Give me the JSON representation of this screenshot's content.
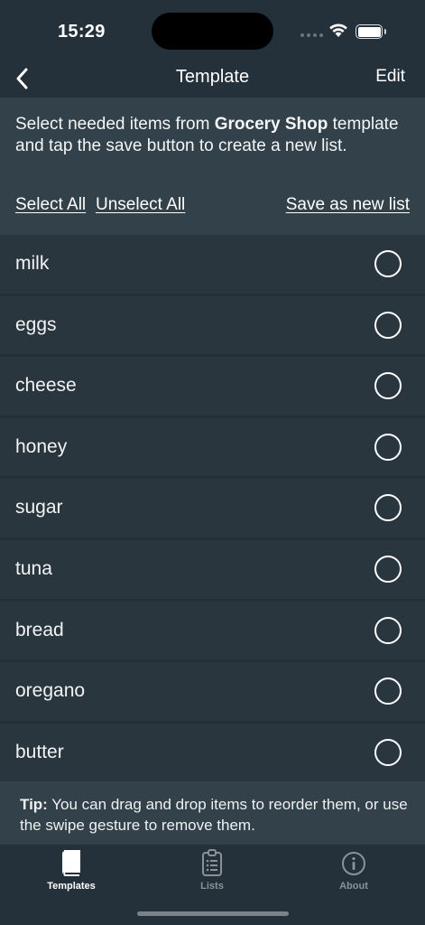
{
  "status_bar": {
    "time": "15:29"
  },
  "nav": {
    "title": "Template",
    "edit_label": "Edit",
    "back_icon": "chevron-left-icon"
  },
  "header": {
    "intro_prefix": "Select needed items from ",
    "template_name": "Grocery Shop",
    "intro_suffix": " template and tap the save button to create a new list.",
    "select_all": "Select All",
    "unselect_all": "Unselect All",
    "save_new": "Save as new list"
  },
  "items": [
    {
      "label": "milk",
      "selected": false
    },
    {
      "label": "eggs",
      "selected": false
    },
    {
      "label": "cheese",
      "selected": false
    },
    {
      "label": "honey",
      "selected": false
    },
    {
      "label": "sugar",
      "selected": false
    },
    {
      "label": "tuna",
      "selected": false
    },
    {
      "label": "bread",
      "selected": false
    },
    {
      "label": "oregano",
      "selected": false
    },
    {
      "label": "butter",
      "selected": false
    }
  ],
  "tip": {
    "prefix": "Tip:",
    "text": " You can drag and drop items to reorder them, or use the swipe gesture to remove them."
  },
  "tabs": [
    {
      "label": "Templates",
      "icon": "book-icon",
      "active": true
    },
    {
      "label": "Lists",
      "icon": "clipboard-list-icon",
      "active": false
    },
    {
      "label": "About",
      "icon": "info-icon",
      "active": false
    }
  ],
  "colors": {
    "background": "#2a363e",
    "header_background": "#32414a",
    "bar_background": "#25313a",
    "inactive_tab": "#8a9297"
  }
}
